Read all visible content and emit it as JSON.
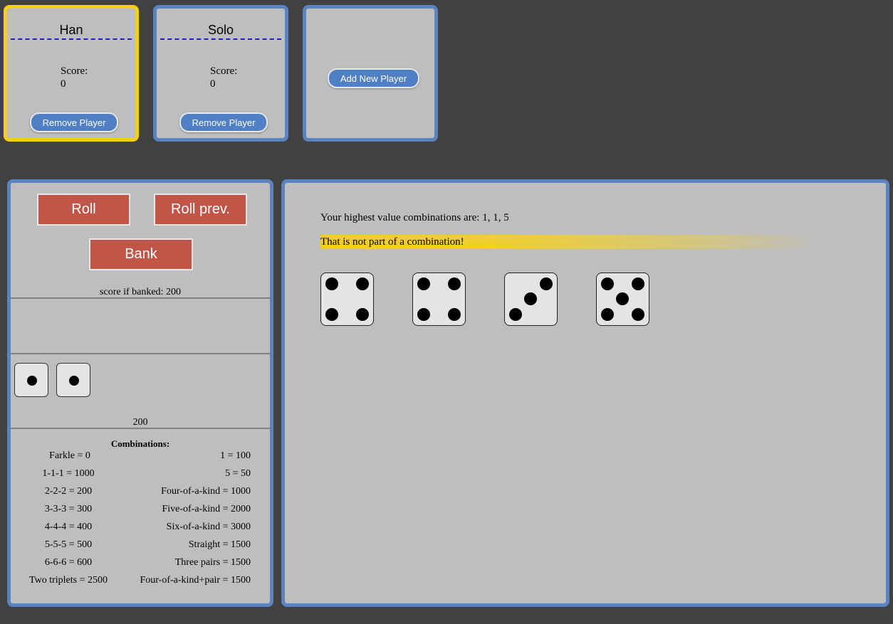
{
  "players": [
    {
      "name": "Han",
      "score_label": "Score:",
      "score": "0",
      "remove_label": "Remove Player",
      "active": true
    },
    {
      "name": "Solo",
      "score_label": "Score:",
      "score": "0",
      "remove_label": "Remove Player",
      "active": false
    }
  ],
  "add_player_label": "Add New Player",
  "controls": {
    "roll_label": "Roll",
    "roll_prev_label": "Roll prev.",
    "bank_label": "Bank",
    "score_if_banked": "score if banked: 200"
  },
  "set_aside": {
    "dice": [
      1,
      1
    ],
    "total": "200"
  },
  "combinations": {
    "title": "Combinations:",
    "left": [
      "Farkle = 0",
      "1-1-1 = 1000",
      "2-2-2 = 200",
      "3-3-3 = 300",
      "4-4-4 = 400",
      "5-5-5 = 500",
      "6-6-6 = 600",
      "Two triplets = 2500"
    ],
    "right": [
      "1 = 100",
      "5 = 50",
      "Four-of-a-kind = 1000",
      "Five-of-a-kind = 2000",
      "Six-of-a-kind = 3000",
      "Straight = 1500",
      "Three pairs = 1500",
      "Four-of-a-kind+pair = 1500"
    ]
  },
  "main": {
    "highest_text": "Your highest value combinations are: 1, 1, 5",
    "message": "That is not part of a combination!",
    "dice": [
      4,
      4,
      3,
      5
    ]
  },
  "colors": {
    "background": "#414141",
    "panel": "#bebebe",
    "panel_border": "#5b83bf",
    "active_border": "#f5cf17",
    "action_button": "#c05548",
    "pill_button": "#4f7fc5",
    "highlight": "#f2cd21"
  }
}
